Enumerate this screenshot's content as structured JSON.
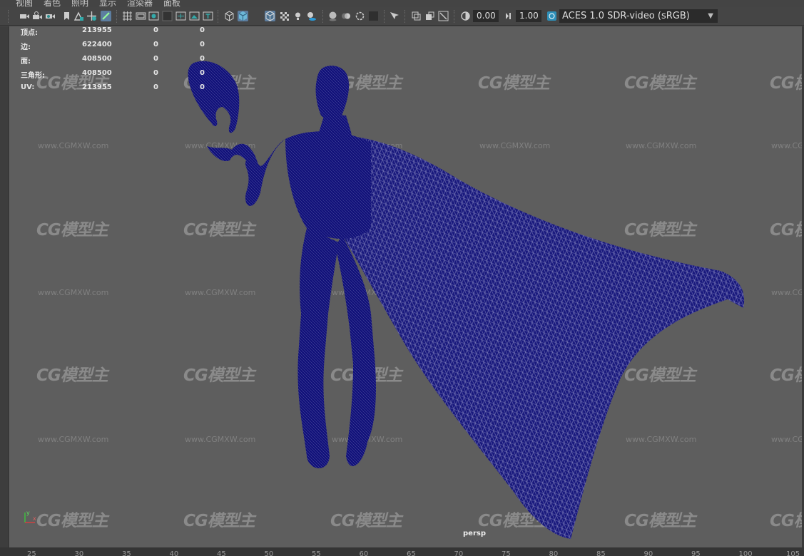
{
  "menu": [
    "视图",
    "着色",
    "照明",
    "显示",
    "渲染器",
    "面板"
  ],
  "toolbar": {
    "exposure": "0.00",
    "gamma": "1.00",
    "color_management": "ACES 1.0 SDR-video (sRGB)",
    "icons": [
      "camera-select-icon",
      "camera-lock-icon",
      "camera-attributes-icon",
      "bookmark-icon",
      "image-plane-icon",
      "two-d-pan-icon",
      "grease-pencil-icon",
      "grid-icon",
      "film-gate-icon",
      "resolution-gate-icon",
      "gate-mask-icon",
      "field-chart-icon",
      "safe-action-icon",
      "safe-title-icon",
      "wireframe-icon",
      "smooth-shade-icon",
      "wireframe-on-shaded-icon",
      "textured-icon",
      "lights-icon",
      "shadows-icon",
      "ambient-occlusion-icon",
      "motion-blur-icon",
      "antialias-icon",
      "depth-of-field-icon",
      "isolate-select-icon",
      "xray-icon",
      "xray-joints-icon",
      "xray-components-icon",
      "exposure-icon",
      "gamma-icon",
      "color-management-icon"
    ]
  },
  "hud": {
    "rows": [
      {
        "label": "顶点:",
        "values": [
          "213955",
          "0",
          "0"
        ]
      },
      {
        "label": "边:",
        "values": [
          "622400",
          "0",
          "0"
        ]
      },
      {
        "label": "面:",
        "values": [
          "408500",
          "0",
          "0"
        ]
      },
      {
        "label": "三角形:",
        "values": [
          "408500",
          "0",
          "0"
        ]
      },
      {
        "label": "UV:",
        "values": [
          "213955",
          "0",
          "0"
        ]
      }
    ]
  },
  "viewport": {
    "camera": "persp",
    "watermark": "CG模型主",
    "watermark_url": "www.CGMXW.com",
    "mesh_color": "#16167a",
    "background": "#5e5e5e"
  },
  "axis": {
    "x": "x",
    "y": "y"
  },
  "timeline": {
    "ticks": [
      "25",
      "30",
      "35",
      "40",
      "45",
      "50",
      "55",
      "60",
      "65",
      "70",
      "75",
      "80",
      "85",
      "90",
      "95",
      "100",
      "105"
    ]
  }
}
